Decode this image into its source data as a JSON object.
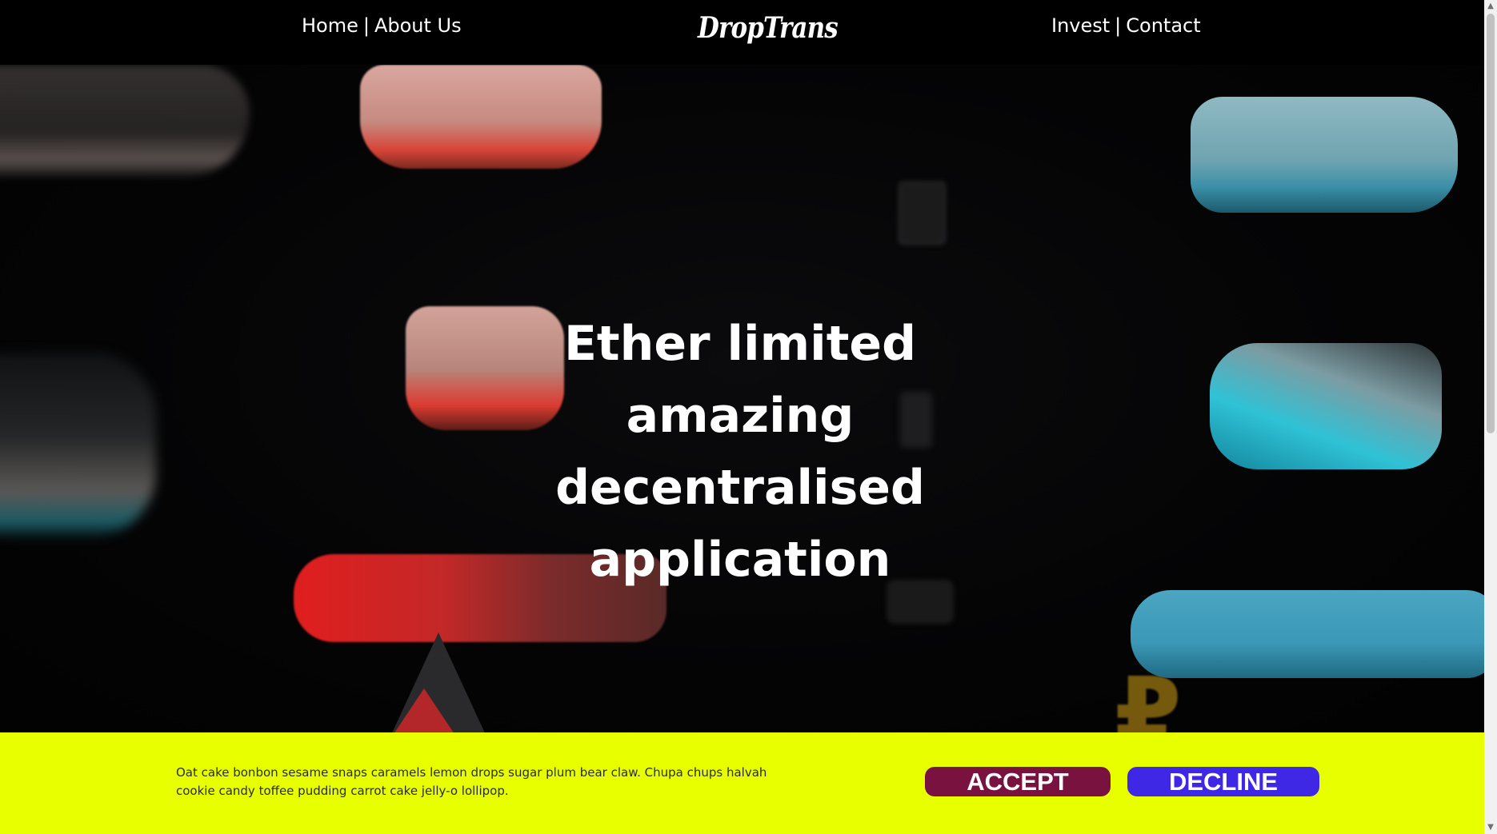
{
  "nav": {
    "home": "Home",
    "about": "About Us",
    "invest": "Invest",
    "contact": "Contact",
    "separator": "|"
  },
  "logo": {
    "text": "DropTrans"
  },
  "hero": {
    "headline_lines": [
      "Ether limited",
      "amazing",
      "decentralised",
      "application"
    ]
  },
  "cookie_banner": {
    "text": "Oat cake bonbon sesame snaps caramels lemon drops sugar plum bear claw. Chupa chups halvah cookie candy toffee pudding carrot cake jelly-o lollipop.",
    "accept_label": "ACCEPT",
    "decline_label": "DECLINE",
    "background": "#e8ff00",
    "accept_color": "#7a1240",
    "decline_color": "#3f27e6"
  },
  "scrollbar": {
    "up_icon": "▲",
    "down_icon": "▼"
  }
}
